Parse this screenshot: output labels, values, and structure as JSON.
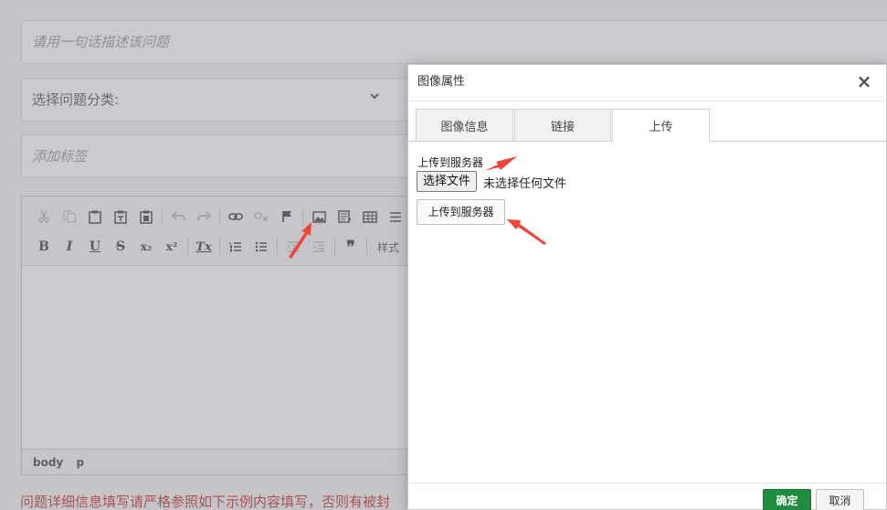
{
  "form": {
    "title_placeholder": "请用一句话描述该问题",
    "category_select": "选择问题分类:",
    "tags_placeholder": "添加标签",
    "hint_text": "问题详细信息填写请严格参照如下示例内容填写，否则有被封"
  },
  "editor": {
    "toolbar_row2": {
      "bold": "B",
      "italic": "I",
      "underline": "U",
      "strike": "S",
      "subscript": "x₂",
      "superscript": "x²",
      "remove_format": "Tx",
      "quote": "❞",
      "styles_label": "样式"
    },
    "path": [
      "body",
      "p"
    ]
  },
  "dialog": {
    "title": "图像属性",
    "tabs": [
      {
        "label": "图像信息",
        "active": false
      },
      {
        "label": "链接",
        "active": false
      },
      {
        "label": "上传",
        "active": true
      }
    ],
    "upload_label": "上传到服务器",
    "choose_file_button": "选择文件",
    "no_file_text": "未选择任何文件",
    "upload_button": "上传到服务器",
    "ok_button": "确定",
    "cancel_button": "取消"
  },
  "colors": {
    "annotation_arrow": "#f0433a",
    "ok_button": "#1e8e3e",
    "hint_text": "#c9302c"
  }
}
